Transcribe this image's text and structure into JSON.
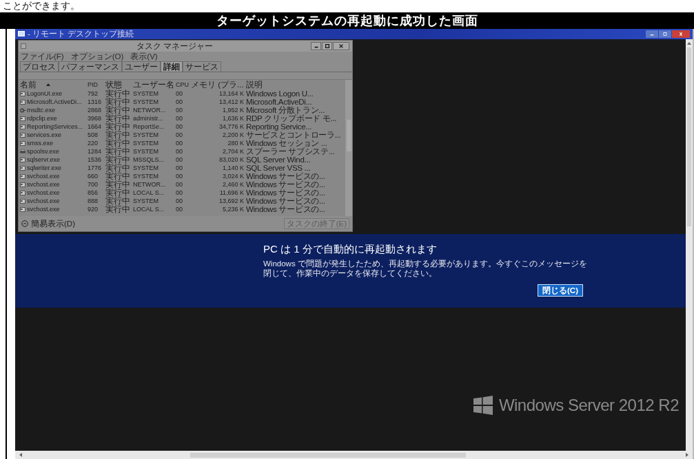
{
  "caption_above": "ことができます。",
  "banner_title": "ターゲットシステムの再起動に成功した画面",
  "rdp_window": {
    "title": "- リモート デスクトップ接続"
  },
  "task_manager": {
    "title": "タスク マネージャー",
    "menu": [
      "ファイル(F)",
      "オプション(O)",
      "表示(V)"
    ],
    "tabs": [
      {
        "label": "プロセス",
        "selected": false
      },
      {
        "label": "パフォーマンス",
        "selected": false
      },
      {
        "label": "ユーザー",
        "selected": false
      },
      {
        "label": "詳細",
        "selected": true
      },
      {
        "label": "サービス",
        "selected": false
      }
    ],
    "columns": [
      "名前",
      "PID",
      "状態",
      "ユーザー名",
      "CPU",
      "メモリ (プラ...",
      "説明"
    ],
    "rows": [
      {
        "kind": "app",
        "name": "LogonUI.exe",
        "pid": "792",
        "status": "実行中",
        "user": "SYSTEM",
        "cpu": "00",
        "memory": "13,164 K",
        "description": "Windows Logon U..."
      },
      {
        "kind": "app",
        "name": "Microsoft.ActiveDi...",
        "pid": "1316",
        "status": "実行中",
        "user": "SYSTEM",
        "cpu": "00",
        "memory": "13,412 K",
        "description": "Microsoft.ActiveDi..."
      },
      {
        "kind": "service",
        "name": "msdtc.exe",
        "pid": "2868",
        "status": "実行中",
        "user": "NETWOR...",
        "cpu": "00",
        "memory": "1,952 K",
        "description": "Microsoft 分散トラン..."
      },
      {
        "kind": "app",
        "name": "rdpclip.exe",
        "pid": "3968",
        "status": "実行中",
        "user": "administr...",
        "cpu": "00",
        "memory": "1,636 K",
        "description": "RDP クリップボード モ..."
      },
      {
        "kind": "app",
        "name": "ReportingServices...",
        "pid": "1664",
        "status": "実行中",
        "user": "ReportSe...",
        "cpu": "00",
        "memory": "34,776 K",
        "description": "Reporting Service..."
      },
      {
        "kind": "app",
        "name": "services.exe",
        "pid": "508",
        "status": "実行中",
        "user": "SYSTEM",
        "cpu": "00",
        "memory": "2,200 K",
        "description": "サービスとコントローラ..."
      },
      {
        "kind": "app",
        "name": "smss.exe",
        "pid": "220",
        "status": "実行中",
        "user": "SYSTEM",
        "cpu": "00",
        "memory": "280 K",
        "description": "Windows セッション ..."
      },
      {
        "kind": "printer",
        "name": "spoolsv.exe",
        "pid": "1284",
        "status": "実行中",
        "user": "SYSTEM",
        "cpu": "00",
        "memory": "2,704 K",
        "description": "スプーラー サブシステ..."
      },
      {
        "kind": "app",
        "name": "sqlservr.exe",
        "pid": "1536",
        "status": "実行中",
        "user": "MSSQLS...",
        "cpu": "00",
        "memory": "83,020 K",
        "description": "SQL Server Wind..."
      },
      {
        "kind": "app",
        "name": "sqlwriter.exe",
        "pid": "1776",
        "status": "実行中",
        "user": "SYSTEM",
        "cpu": "00",
        "memory": "1,140 K",
        "description": "SQL Server VSS ..."
      },
      {
        "kind": "app",
        "name": "svchost.exe",
        "pid": "660",
        "status": "実行中",
        "user": "SYSTEM",
        "cpu": "00",
        "memory": "3,024 K",
        "description": "Windows サービスの..."
      },
      {
        "kind": "app",
        "name": "svchost.exe",
        "pid": "700",
        "status": "実行中",
        "user": "NETWOR...",
        "cpu": "00",
        "memory": "2,460 K",
        "description": "Windows サービスの..."
      },
      {
        "kind": "app",
        "name": "svchost.exe",
        "pid": "856",
        "status": "実行中",
        "user": "LOCAL S...",
        "cpu": "00",
        "memory": "11,696 K",
        "description": "Windows サービスの..."
      },
      {
        "kind": "app",
        "name": "svchost.exe",
        "pid": "888",
        "status": "実行中",
        "user": "SYSTEM",
        "cpu": "00",
        "memory": "13,692 K",
        "description": "Windows サービスの..."
      },
      {
        "kind": "app",
        "name": "svchost.exe",
        "pid": "920",
        "status": "実行中",
        "user": "LOCAL S...",
        "cpu": "00",
        "memory": "5,236 K",
        "description": "Windows サービスの..."
      }
    ],
    "footer": {
      "toggle_label": "簡易表示(D)",
      "end_task": {
        "label": "タスクの終了(E)",
        "disabled": true
      }
    }
  },
  "restart_notice": {
    "heading": "PC は 1 分で自動的に再起動されます",
    "message": "Windows で問題が発生したため、再起動する必要があります。今すぐこのメッセージを閉じて、作業中のデータを保存してください。",
    "button": "閉じる(C)"
  },
  "os_logo_text": "Windows Server 2012 R2"
}
